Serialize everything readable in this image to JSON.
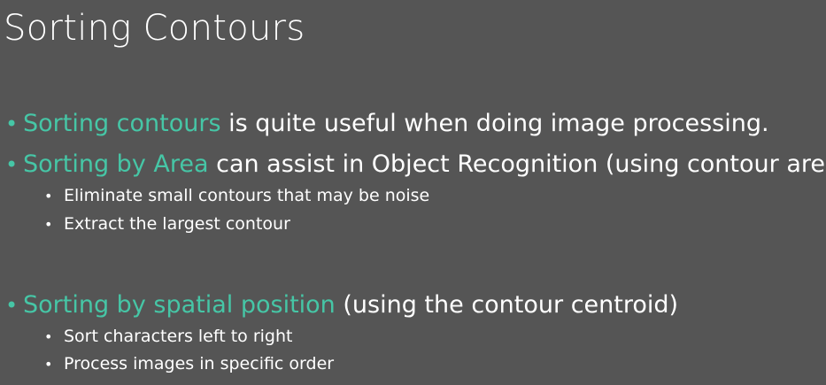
{
  "slide": {
    "title": "Sorting Contours",
    "accent_color": "#46c6a6",
    "background_color": "#555555",
    "text_color": "#ffffff",
    "bullets": [
      {
        "highlight": "Sorting contours",
        "rest": " is quite useful when doing image processing."
      },
      {
        "highlight": "Sorting by Area",
        "rest": " can assist in Object Recognition (using contour area)",
        "subitems": [
          "Eliminate small contours that may be noise",
          "Extract the largest contour"
        ]
      },
      {
        "highlight": "Sorting by spatial position",
        "rest": " (using the contour centroid)",
        "subitems": [
          "Sort characters left to right",
          "Process images in specific order"
        ]
      }
    ]
  }
}
